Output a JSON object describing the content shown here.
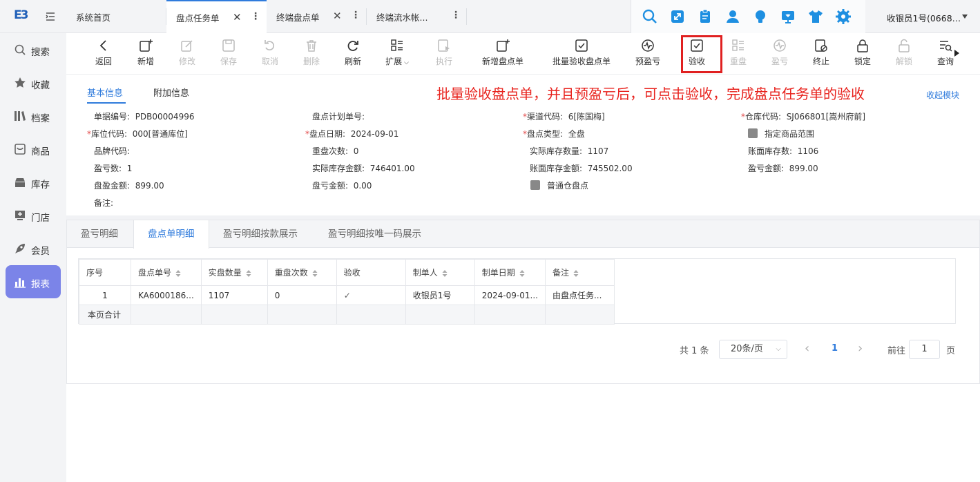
{
  "app": {
    "logo_text": "E3",
    "user": "收银员1号(0668…"
  },
  "tabs": [
    {
      "label": "系统首页"
    },
    {
      "label": "盘点任务单"
    },
    {
      "label": "终端盘点单"
    },
    {
      "label": "终端流水帐..."
    }
  ],
  "top_icons": [
    "search-icon",
    "expand-icon",
    "clipboard-icon",
    "user-icon",
    "bulb-icon",
    "monitor-icon",
    "shirt-icon",
    "gear-icon"
  ],
  "sidebar": [
    {
      "label": "搜索",
      "icon": "search-icon"
    },
    {
      "label": "收藏",
      "icon": "star-icon"
    },
    {
      "label": "档案",
      "icon": "archive-icon"
    },
    {
      "label": "商品",
      "icon": "product-icon"
    },
    {
      "label": "库存",
      "icon": "inventory-icon"
    },
    {
      "label": "门店",
      "icon": "store-icon"
    },
    {
      "label": "会员",
      "icon": "member-icon"
    },
    {
      "label": "报表",
      "icon": "report-icon"
    }
  ],
  "toolbar": {
    "back": "返回",
    "add": "新增",
    "edit": "修改",
    "save": "保存",
    "cancel": "取消",
    "delete": "删除",
    "refresh": "刷新",
    "extend": "扩展",
    "execute": "执行",
    "new_count": "新增盘点单",
    "batch_verify": "批量验收盘点单",
    "pre_pl": "预盈亏",
    "verify": "验收",
    "recount": "重盘",
    "profit_loss": "盈亏",
    "terminate": "终止",
    "lock": "锁定",
    "unlock": "解锁",
    "query": "查询"
  },
  "info": {
    "tab_basic": "基本信息",
    "tab_extra": "附加信息",
    "annotation": "批量验收盘点单，并且预盈亏后，可点击验收，完成盘点任务单的验收",
    "collapse": "收起模块",
    "fields": {
      "doc_no": {
        "label": "单据编号:",
        "value": "PDB00004996"
      },
      "plan_no": {
        "label": "盘点计划单号:",
        "value": ""
      },
      "channel": {
        "label": "渠道代码:",
        "value": "6[陈国梅]"
      },
      "warehouse": {
        "label": "仓库代码:",
        "value": "SJ066801[嵩州府前]"
      },
      "location": {
        "label": "库位代码:",
        "value": "000[普通库位]"
      },
      "count_date": {
        "label": "盘点日期:",
        "value": "2024-09-01"
      },
      "count_type": {
        "label": "盘点类型:",
        "value": "全盘"
      },
      "spec_range": {
        "label": "指定商品范围",
        "value": ""
      },
      "brand": {
        "label": "品牌代码:",
        "value": ""
      },
      "recount_times": {
        "label": "重盘次数:",
        "value": "0"
      },
      "actual_qty": {
        "label": "实际库存数量:",
        "value": "1107"
      },
      "book_qty": {
        "label": "账面库存数:",
        "value": "1106"
      },
      "pl_count": {
        "label": "盈亏数:",
        "value": "1"
      },
      "actual_amount": {
        "label": "实际库存金额:",
        "value": "746401.00"
      },
      "book_amount": {
        "label": "账面库存金额:",
        "value": "745502.00"
      },
      "pl_amount": {
        "label": "盈亏金额:",
        "value": "899.00"
      },
      "gain_amount": {
        "label": "盘盈金额:",
        "value": "899.00"
      },
      "loss_amount": {
        "label": "盘亏金额:",
        "value": "0.00"
      },
      "normal_wh": {
        "label": "普通仓盘点",
        "value": ""
      },
      "remark": {
        "label": "备注:",
        "value": ""
      }
    }
  },
  "detail": {
    "tabs": [
      "盈亏明细",
      "盘点单明细",
      "盈亏明细按款展示",
      "盈亏明细按唯一码展示"
    ],
    "columns": [
      "序号",
      "盘点单号",
      "实盘数量",
      "重盘次数",
      "验收",
      "制单人",
      "制单日期",
      "备注"
    ],
    "rows": [
      {
        "seq": "1",
        "count_no": "KA6000186...",
        "qty": "1107",
        "recount": "0",
        "verified": "✓",
        "creator": "收银员1号",
        "date": "2024-09-01...",
        "remark": "由盘点任务..."
      }
    ],
    "footer_label": "本页合计"
  },
  "pager": {
    "total": "共 1 条",
    "page_size": "20条/页",
    "prev": "‹",
    "current": "1",
    "next": "›",
    "goto_label": "前往",
    "goto_value": "1",
    "page_suffix": "页"
  }
}
